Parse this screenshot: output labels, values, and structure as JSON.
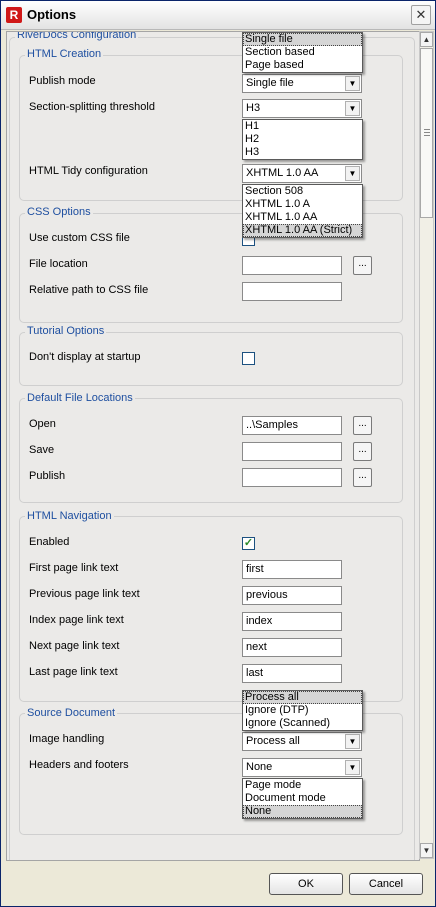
{
  "window": {
    "title": "Options",
    "app_icon_letter": "R"
  },
  "config": {
    "title": "RiverDocs Configuration"
  },
  "html_creation": {
    "title": "HTML Creation",
    "publish_mode": {
      "label": "Publish mode",
      "value": "Single file",
      "options": [
        "Single file",
        "Section based",
        "Page based"
      ]
    },
    "section_threshold": {
      "label": "Section-splitting threshold",
      "value": "H3",
      "options": [
        "H1",
        "H2",
        "H3"
      ]
    },
    "tidy": {
      "label": "HTML Tidy configuration",
      "value": "XHTML 1.0 AA",
      "options": [
        "Section 508",
        "XHTML 1.0 A",
        "XHTML 1.0 AA",
        "XHTML 1.0 AA (Strict)"
      ]
    }
  },
  "css_options": {
    "title": "CSS Options",
    "use_custom": {
      "label": "Use custom CSS file"
    },
    "file_location": {
      "label": "File location",
      "value": ""
    },
    "relative_path": {
      "label": "Relative path to CSS file",
      "value": ""
    }
  },
  "tutorial_options": {
    "title": "Tutorial Options",
    "dont_display": {
      "label": "Don't display at startup"
    }
  },
  "default_locations": {
    "title": "Default File Locations",
    "open": {
      "label": "Open",
      "value": "..\\Samples"
    },
    "save": {
      "label": "Save",
      "value": ""
    },
    "publish": {
      "label": "Publish",
      "value": ""
    },
    "browse_label": "..."
  },
  "html_navigation": {
    "title": "HTML Navigation",
    "enabled": {
      "label": "Enabled",
      "check": "✓"
    },
    "first": {
      "label": "First page link text",
      "value": "first"
    },
    "previous": {
      "label": "Previous page link text",
      "value": "previous"
    },
    "index": {
      "label": "Index page link text",
      "value": "index"
    },
    "next": {
      "label": "Next page link text",
      "value": "next"
    },
    "last": {
      "label": "Last page link text",
      "value": "last"
    }
  },
  "source_document": {
    "title": "Source Document",
    "image_handling": {
      "label": "Image handling",
      "value": "Process all",
      "options": [
        "Process all",
        "Ignore (DTP)",
        "Ignore (Scanned)"
      ]
    },
    "headers_footers": {
      "label": "Headers and footers",
      "value": "None",
      "options": [
        "Page mode",
        "Document mode",
        "None"
      ]
    }
  },
  "buttons": {
    "ok": "OK",
    "cancel": "Cancel"
  },
  "glyphs": {
    "close": "✕",
    "arrow_down": "▼",
    "arrow_up": "▲"
  }
}
